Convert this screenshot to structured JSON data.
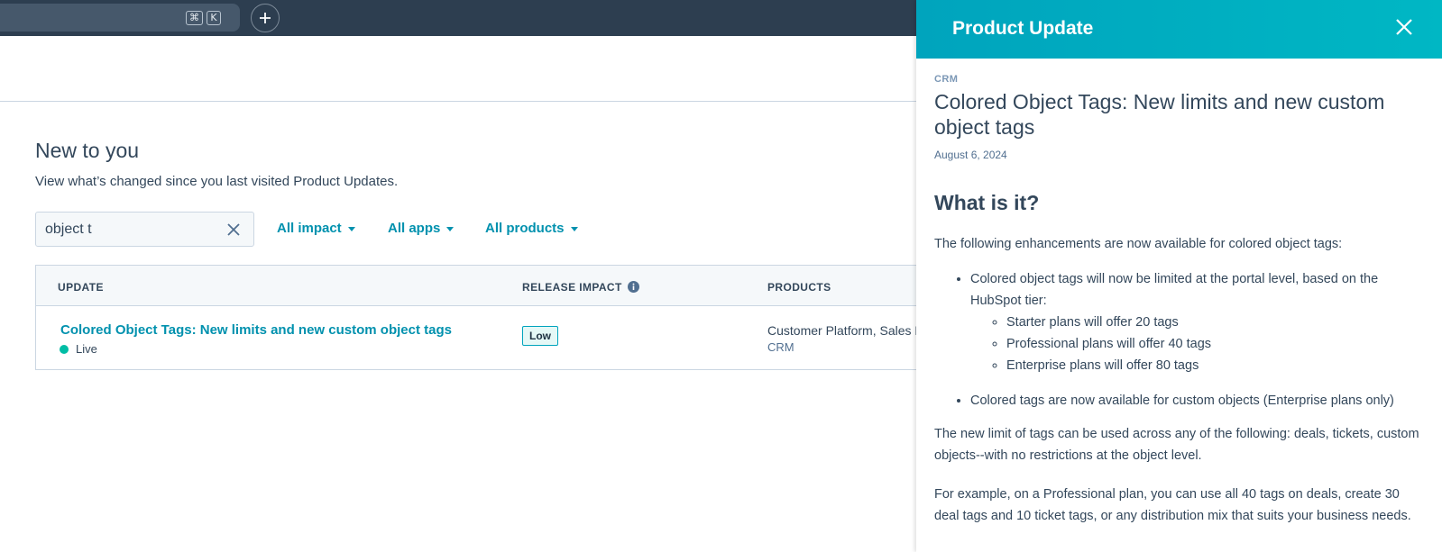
{
  "topbar": {
    "shortcut_cmd": "⌘",
    "shortcut_k": "K"
  },
  "main": {
    "title": "New to you",
    "subtitle": "View what’s changed since you last visited Product Updates.",
    "search": {
      "value": "object t"
    },
    "filters": [
      {
        "label": "All impact"
      },
      {
        "label": "All apps"
      },
      {
        "label": "All products"
      }
    ],
    "table": {
      "headers": [
        "UPDATE",
        "RELEASE IMPACT",
        "PRODUCTS"
      ],
      "rows": [
        {
          "title": "Colored Object Tags: New limits and new custom object tags",
          "status": "Live",
          "impact": "Low",
          "products": "Customer Platform, Sales Hub",
          "category": "CRM"
        }
      ]
    }
  },
  "panel": {
    "header_title": "Product Update",
    "category": "CRM",
    "title": "Colored Object Tags: New limits and new custom object tags",
    "date": "August 6, 2024",
    "section_heading": "What is it?",
    "intro": "The following enhancements are now available for colored object tags:",
    "bullets": [
      {
        "text": "Colored object tags will now be limited at the portal level, based on the HubSpot tier:",
        "sub": [
          "Starter plans will offer 20 tags",
          "Professional plans will offer 40 tags",
          "Enterprise plans will offer 80 tags"
        ]
      },
      {
        "text": "Colored tags are now available for custom objects (Enterprise plans only)"
      }
    ],
    "para2": "The new limit of tags can be used across any of the following: deals, tickets, custom objects--with no restrictions at the object level.",
    "para3": "For example, on a Professional plan, you can use all 40 tags on deals, create 30 deal tags and 10 ticket tags, or any distribution mix that suits your business needs."
  },
  "colors": {
    "accent": "#0091ae",
    "panel_header": "#00a4bd",
    "live_dot": "#00bda5",
    "topbar": "#2d3e50"
  },
  "icons": [
    "plus-icon",
    "clear-icon",
    "info-icon",
    "close-icon",
    "caret-down-icon"
  ]
}
